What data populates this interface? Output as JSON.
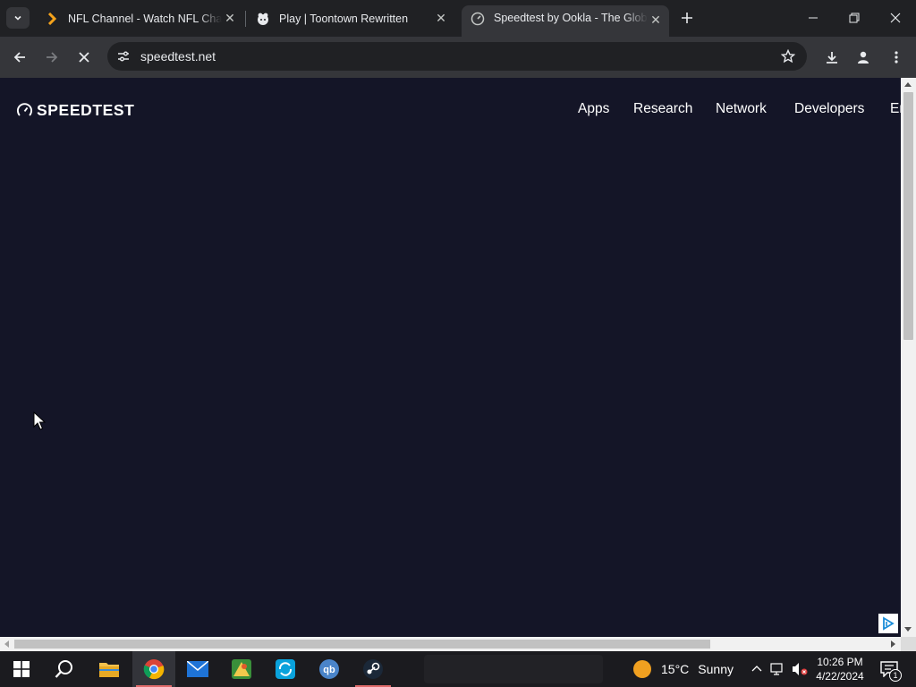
{
  "browser": {
    "tabs": [
      {
        "title": "NFL Channel - Watch NFL Channel",
        "icon": "nfl-chevron-icon"
      },
      {
        "title": "Play | Toontown Rewritten",
        "icon": "toontown-icon"
      },
      {
        "title": "Speedtest by Ookla - The Global Broadband Speed Test",
        "icon": "speedtest-icon",
        "active": true
      }
    ],
    "url": "speedtest.net",
    "accent": "#35363a"
  },
  "page": {
    "logo_text": "SPEEDTEST",
    "nav": [
      "Apps",
      "Research",
      "Network",
      "Developers",
      "Enterprise"
    ],
    "background": "#141527"
  },
  "taskbar": {
    "weather_temp": "15°C",
    "weather_text": "Sunny",
    "time": "10:26 PM",
    "date": "4/22/2024",
    "notification_count": "1"
  }
}
